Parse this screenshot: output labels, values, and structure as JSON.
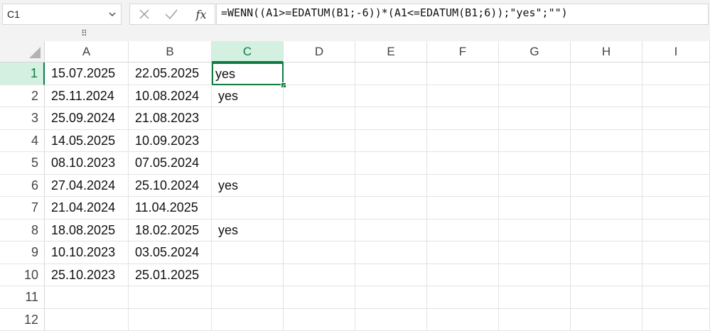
{
  "name_box": {
    "value": "C1"
  },
  "formula_bar": {
    "formula": "=WENN((A1>=EDATUM(B1;-6))*(A1<=EDATUM(B1;6));\"yes\";\"\")",
    "fx_label": "fx"
  },
  "columns": [
    "A",
    "B",
    "C",
    "D",
    "E",
    "F",
    "G",
    "H",
    "I"
  ],
  "rows": [
    "1",
    "2",
    "3",
    "4",
    "5",
    "6",
    "7",
    "8",
    "9",
    "10",
    "11",
    "12"
  ],
  "selected": {
    "column": "C",
    "row": "1"
  },
  "cells": [
    [
      "15.07.2025",
      "22.05.2025",
      "yes"
    ],
    [
      "25.11.2024",
      "10.08.2024",
      "yes"
    ],
    [
      "25.09.2024",
      "21.08.2023",
      ""
    ],
    [
      "14.05.2025",
      "10.09.2023",
      ""
    ],
    [
      "08.10.2023",
      "07.05.2024",
      ""
    ],
    [
      "27.04.2024",
      "25.10.2024",
      "yes"
    ],
    [
      "21.04.2024",
      "11.04.2025",
      ""
    ],
    [
      "18.08.2025",
      "18.02.2025",
      "yes"
    ],
    [
      "10.10.2023",
      "03.05.2024",
      ""
    ],
    [
      "25.10.2023",
      "25.01.2025",
      ""
    ],
    [
      "",
      "",
      ""
    ],
    [
      "",
      "",
      ""
    ]
  ],
  "colors": {
    "accent": "#107c41",
    "selected_header_bg": "#d3f0e0",
    "toolbar_bg": "#f3f3f3"
  },
  "icons": {
    "name_box_dropdown": "chevron-down-icon",
    "cancel": "close-icon",
    "confirm": "check-icon",
    "grip": "grip-dots-icon",
    "select_all": "select-all-triangle-icon"
  }
}
